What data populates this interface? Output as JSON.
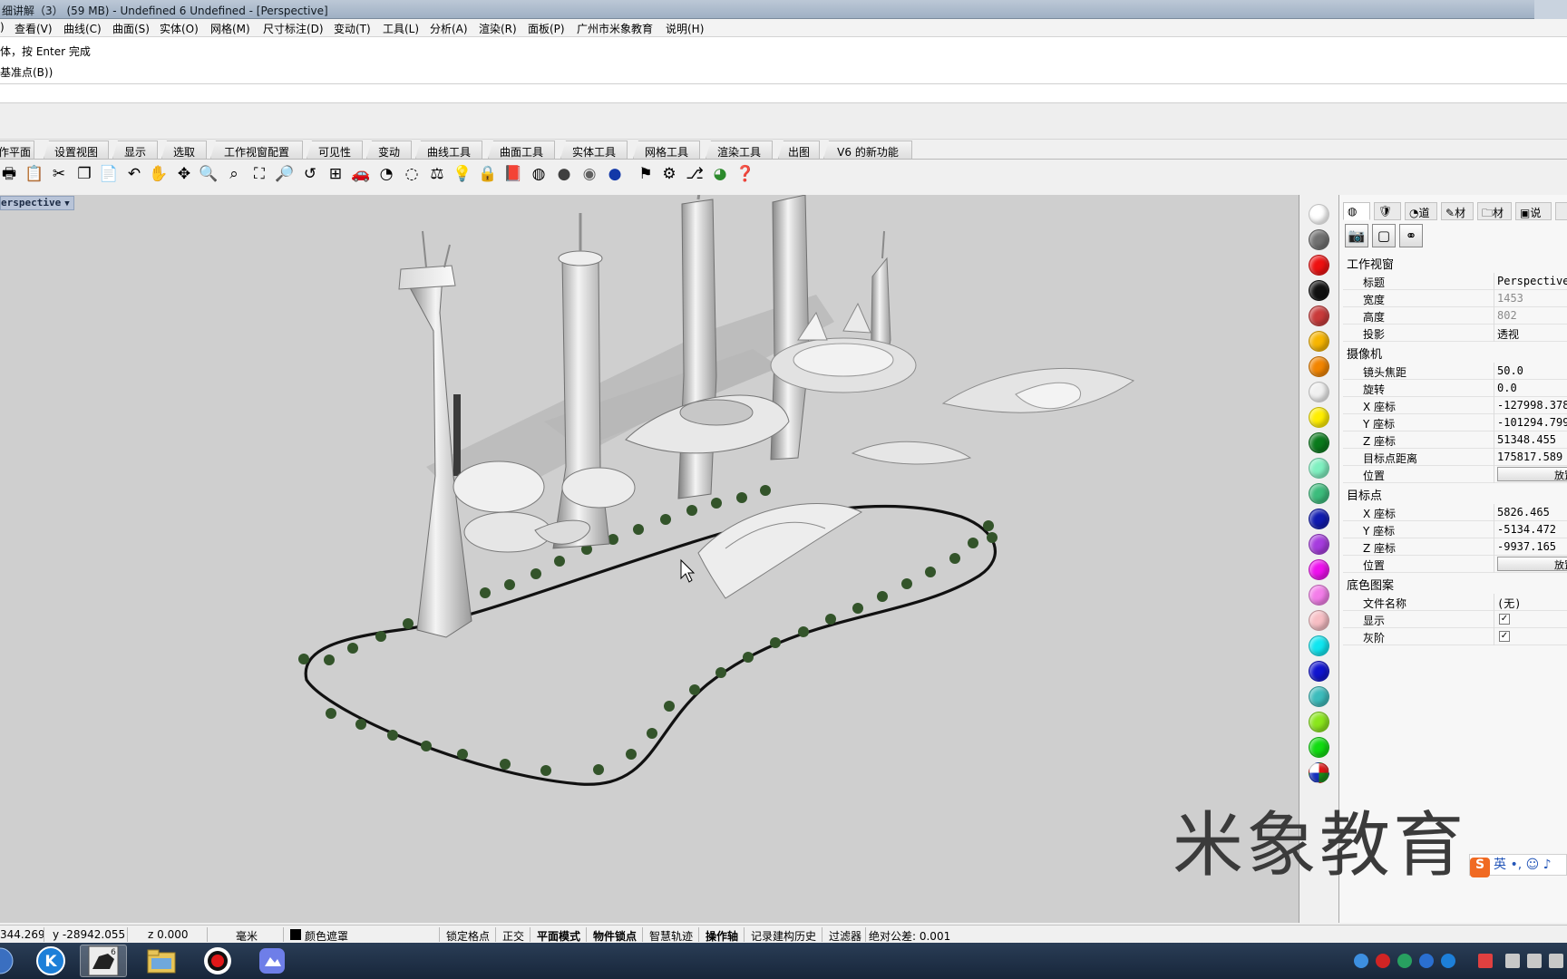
{
  "window": {
    "title": "细讲解（3） (59 MB) - Undefined 6 Undefined - [Perspective]"
  },
  "menu": [
    {
      "label": "查看(V)"
    },
    {
      "label": "曲线(C)"
    },
    {
      "label": "曲面(S)"
    },
    {
      "label": "实体(O)"
    },
    {
      "label": "网格(M)"
    },
    {
      "label": "尺寸标注(D)"
    },
    {
      "label": "变动(T)"
    },
    {
      "label": "工具(L)"
    },
    {
      "label": "分析(A)"
    },
    {
      "label": "渲染(R)"
    },
    {
      "label": "面板(P)"
    },
    {
      "label": "广州市米象教育"
    },
    {
      "label": "说明(H)"
    }
  ],
  "command": {
    "line1": "体，按 Enter 完成",
    "line2": "基准点(B))"
  },
  "tabs": [
    {
      "label": "作平面"
    },
    {
      "label": "设置视图"
    },
    {
      "label": "显示"
    },
    {
      "label": "选取"
    },
    {
      "label": "工作视窗配置"
    },
    {
      "label": "可见性"
    },
    {
      "label": "变动"
    },
    {
      "label": "曲线工具"
    },
    {
      "label": "曲面工具"
    },
    {
      "label": "实体工具"
    },
    {
      "label": "网格工具"
    },
    {
      "label": "渲染工具"
    },
    {
      "label": "出图"
    },
    {
      "label": "V6 的新功能"
    }
  ],
  "toolbar_icons": [
    "print-icon",
    "copy-to-clipboard-icon",
    "cut-icon",
    "copy-icon",
    "paste-icon",
    "undo-icon",
    "pan-hand-icon",
    "rotate-view-icon",
    "zoom-in-icon",
    "zoom-window-icon",
    "zoom-extents-icon",
    "zoom-selected-icon",
    "undo-view-icon",
    "four-viewports-icon",
    "car-icon",
    "mouse-icon",
    "circle-select-icon",
    "analyze-icon",
    "lightbulb-icon",
    "lock-icon",
    "layer-book-icon",
    "color-wheel-icon",
    "render-sphere-icon",
    "render-preview-sphere-icon",
    "material-sphere-icon",
    "flag-icon",
    "gear-mesh-icon",
    "history-icon",
    "globe-icon",
    "help-icon"
  ],
  "viewport": {
    "label": "erspective"
  },
  "swatches": [
    "#ffffff",
    "#707070",
    "#ee1111",
    "#111111",
    "#c93a3a",
    "#f7b500",
    "#f28500",
    "#f0f0f0",
    "#ffee00",
    "#0a7a1c",
    "#7ff0c0",
    "#3cbc7c",
    "#101bb0",
    "#a63cde",
    "#ee10ee",
    "#f37de9",
    "#f7bec4",
    "#10e6f0",
    "#1014cf",
    "#3cbcbc",
    "#8ae61c",
    "#11dc11"
  ],
  "props": {
    "tabs": [
      {
        "label": ""
      },
      {
        "label": ""
      },
      {
        "label": "道"
      },
      {
        "label": "材"
      },
      {
        "label": "材"
      },
      {
        "label": "说"
      }
    ],
    "viewport_section": "工作视窗",
    "camera_section": "摄像机",
    "target_section": "目标点",
    "background_section": "底色图案",
    "rows": {
      "title": {
        "k": "标题",
        "v": "Perspective"
      },
      "width": {
        "k": "宽度",
        "v": "1453"
      },
      "height": {
        "k": "高度",
        "v": "802"
      },
      "projection": {
        "k": "投影",
        "v": "透视"
      },
      "lens": {
        "k": "镜头焦距",
        "v": "50.0"
      },
      "rotation": {
        "k": "旋转",
        "v": "0.0"
      },
      "cam_x": {
        "k": "X 座标",
        "v": "-127998.378"
      },
      "cam_y": {
        "k": "Y 座标",
        "v": "-101294.799"
      },
      "cam_z": {
        "k": "Z 座标",
        "v": "51348.455"
      },
      "target_dist": {
        "k": "目标点距离",
        "v": "175817.589"
      },
      "cam_pos": {
        "k": "位置",
        "v": "放置"
      },
      "tgt_x": {
        "k": "X 座标",
        "v": "5826.465"
      },
      "tgt_y": {
        "k": "Y 座标",
        "v": "-5134.472"
      },
      "tgt_z": {
        "k": "Z 座标",
        "v": "-9937.165"
      },
      "tgt_pos": {
        "k": "位置",
        "v": "放置"
      },
      "filename": {
        "k": "文件名称",
        "v": "(无)"
      },
      "show": {
        "k": "显示",
        "v": "✓"
      },
      "grayscale": {
        "k": "灰阶",
        "v": "✓"
      }
    }
  },
  "watermark": "米象教育",
  "ime": {
    "s": "S",
    "text": "英 •, ☺ ♪"
  },
  "status": {
    "x": "344.269",
    "y": "y -28942.055",
    "z": "z 0.000",
    "unit": "毫米",
    "layer": "颜色遮罩",
    "items": [
      {
        "label": "锁定格点",
        "bold": false
      },
      {
        "label": "正交",
        "bold": false
      },
      {
        "label": "平面模式",
        "bold": true
      },
      {
        "label": "物件锁点",
        "bold": true
      },
      {
        "label": "智慧轨迹",
        "bold": false
      },
      {
        "label": "操作轴",
        "bold": true
      },
      {
        "label": "记录建构历史",
        "bold": false
      },
      {
        "label": "过滤器",
        "bold": false
      }
    ],
    "tolerance": "绝对公差: 0.001"
  }
}
